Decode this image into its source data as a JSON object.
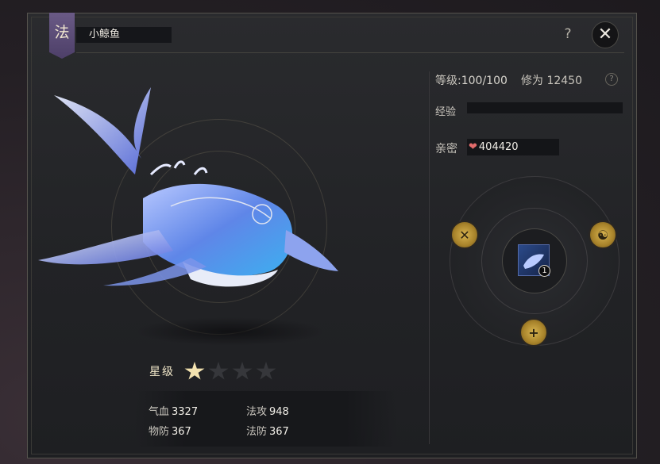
{
  "pet": {
    "type_badge": "法",
    "name": "小鲸鱼"
  },
  "header": {
    "help_label": "?",
    "close_label": "✕"
  },
  "info": {
    "level_label": "等级",
    "level_value": ":100/100",
    "cultivation_label": "修为",
    "cultivation_value": "12450",
    "exp_label": "经验",
    "exp_progress": 0.0,
    "intimacy_label": "亲密",
    "intimacy_value": "404420",
    "info_icon": "?"
  },
  "stars": {
    "label": "星级",
    "filled": 1,
    "total": 4
  },
  "stats": {
    "hp_label": "气血",
    "hp_value": "3327",
    "matk_label": "法攻",
    "matk_value": "948",
    "pdef_label": "物防",
    "pdef_value": "367",
    "mdef_label": "法防",
    "mdef_value": "367"
  },
  "skills": {
    "center_count": "1",
    "icons": [
      "crossed-swords-icon",
      "meditation-icon",
      "add-icon"
    ]
  },
  "colors": {
    "accent_gold": "#d8b450",
    "badge_purple": "#5e4f7c",
    "heart": "#e36c6c"
  }
}
